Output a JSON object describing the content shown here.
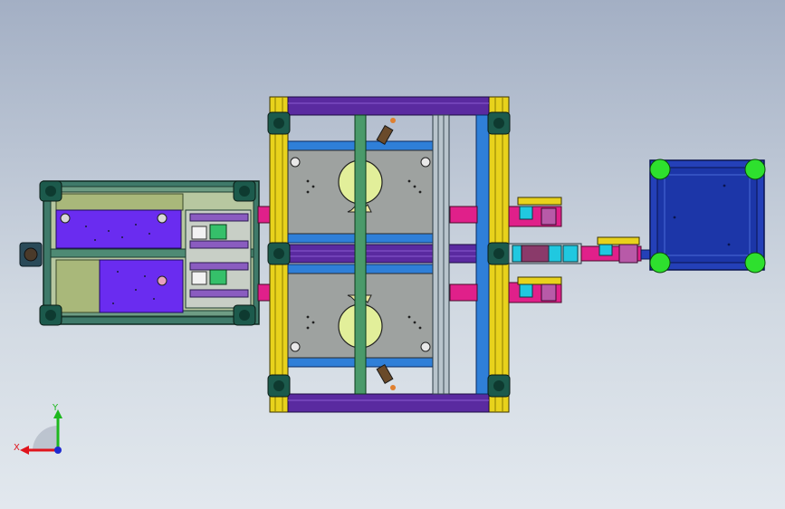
{
  "triad": {
    "x_label": "X",
    "y_label": "Y",
    "x_color": "#e0141c",
    "y_color": "#1eb81e",
    "z_color": "#1e2ad0"
  },
  "palette": {
    "frame_yellow": "#e8d21c",
    "rail_purple": "#5a2aa0",
    "plate_gray": "#9ea2a0",
    "plate_blue": "#2f7fd8",
    "carrier_violet": "#6a2cf0",
    "olive_plate": "#a9b87a",
    "teal_corner": "#1c5a4c",
    "magenta": "#e0208a",
    "cyan": "#20c8e0",
    "blue_tray": "#2440b8",
    "green_wheel": "#2ee02e",
    "disc_yellow": "#e2ef9a"
  }
}
